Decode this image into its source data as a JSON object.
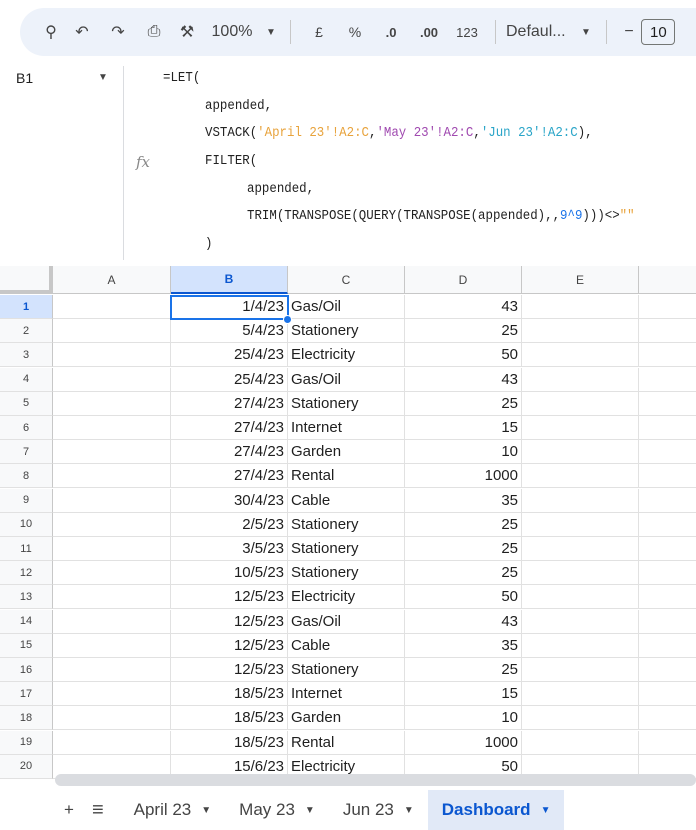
{
  "toolbar": {
    "zoom": "100%",
    "currency": "£",
    "percent": "%",
    "dec_decrease": ".0",
    "dec_increase": ".00",
    "number_format": "123",
    "font": "Defaul...",
    "font_size": "10",
    "minus": "−"
  },
  "name_box": "B1",
  "formula": {
    "l1": "=LET(",
    "l2": "appended,",
    "l3a": "VSTACK(",
    "l3b": "'April 23'!A2:C",
    "l3c": ",",
    "l3d": "'May 23'!A2:C",
    "l3e": ",",
    "l3f": "'Jun 23'!A2:C",
    "l3g": "),",
    "l4": "FILTER(",
    "l5": "appended,",
    "l6a": "TRIM(TRANSPOSE(QUERY(TRANSPOSE(appended),,",
    "l6b": "9^9",
    "l6c": ")))<>",
    "l6d": "\"\"",
    "l7": ")"
  },
  "columns": [
    "A",
    "B",
    "C",
    "D",
    "E"
  ],
  "rows": [
    [
      "1/4/23",
      "Gas/Oil",
      "43"
    ],
    [
      "5/4/23",
      "Stationery",
      "25"
    ],
    [
      "25/4/23",
      "Electricity",
      "50"
    ],
    [
      "25/4/23",
      "Gas/Oil",
      "43"
    ],
    [
      "27/4/23",
      "Stationery",
      "25"
    ],
    [
      "27/4/23",
      "Internet",
      "15"
    ],
    [
      "27/4/23",
      "Garden",
      "10"
    ],
    [
      "27/4/23",
      "Rental",
      "1000"
    ],
    [
      "30/4/23",
      "Cable",
      "35"
    ],
    [
      "2/5/23",
      "Stationery",
      "25"
    ],
    [
      "3/5/23",
      "Stationery",
      "25"
    ],
    [
      "10/5/23",
      "Stationery",
      "25"
    ],
    [
      "12/5/23",
      "Electricity",
      "50"
    ],
    [
      "12/5/23",
      "Gas/Oil",
      "43"
    ],
    [
      "12/5/23",
      "Cable",
      "35"
    ],
    [
      "12/5/23",
      "Stationery",
      "25"
    ],
    [
      "18/5/23",
      "Internet",
      "15"
    ],
    [
      "18/5/23",
      "Garden",
      "10"
    ],
    [
      "18/5/23",
      "Rental",
      "1000"
    ],
    [
      "15/6/23",
      "Electricity",
      "50"
    ]
  ],
  "sheets": [
    {
      "label": "April 23"
    },
    {
      "label": "May 23"
    },
    {
      "label": "Jun 23"
    },
    {
      "label": "Dashboard",
      "active": true
    }
  ]
}
